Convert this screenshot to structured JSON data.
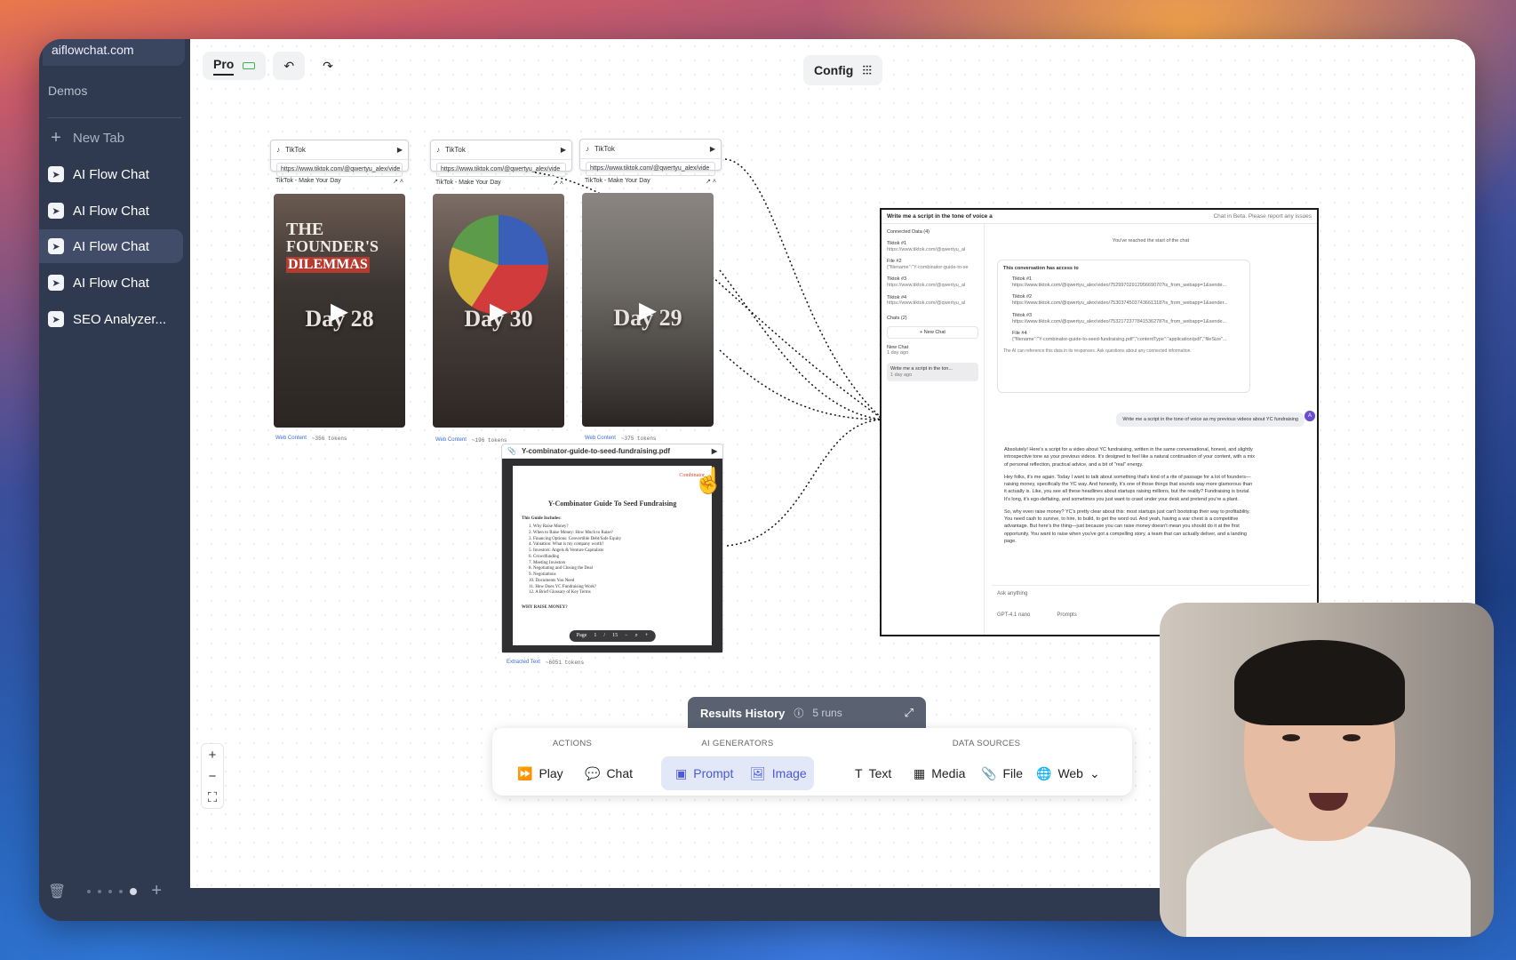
{
  "browser": {
    "domain": "aiflowchat.com"
  },
  "sidebar": {
    "section": "Demos",
    "new_tab": "New Tab",
    "items": [
      {
        "label": "AI Flow Chat",
        "active": false
      },
      {
        "label": "AI Flow Chat",
        "active": false
      },
      {
        "label": "AI Flow Chat",
        "active": true
      },
      {
        "label": "AI Flow Chat",
        "active": false
      },
      {
        "label": "SEO Analyzer...",
        "active": false
      }
    ]
  },
  "topbar": {
    "plan": "Pro",
    "config": "Config"
  },
  "tiktok_nodes": [
    {
      "source": "TikTok",
      "url": "https://www.tiktok.com/@qwertyu_alex/vide",
      "title": "TikTok - Make Your Day",
      "overlay": "Day 28",
      "tag": "Web Content",
      "tokens": "~356 tokens"
    },
    {
      "source": "TikTok",
      "url": "https://www.tiktok.com/@qwertyu_alex/vide",
      "title": "TikTok - Make Your Day",
      "overlay": "Day 30",
      "tag": "Web Content",
      "tokens": "~196 tokens"
    },
    {
      "source": "TikTok",
      "url": "https://www.tiktok.com/@qwertyu_alex/vide",
      "title": "TikTok - Make Your Day",
      "overlay": "Day 29",
      "tag": "Web Content",
      "tokens": "~375 tokens"
    }
  ],
  "video1_caption": [
    "THE",
    "FOUNDER'S",
    "DILEMMAS"
  ],
  "pdf_node": {
    "filename": "Y-combinator-guide-to-seed-fundraising.pdf",
    "brand": "Combinator",
    "heading": "Y-Combinator Guide To Seed Fundraising",
    "includes": "This Guide Includes:",
    "items": [
      "1. Why Raise Money?",
      "2. When to Raise Money: How Much to Raise?",
      "3. Financing Options: Convertible Debt/Safe Equity",
      "4. Valuation: What is my company worth?",
      "5. Investors: Angels & Venture Capitalists",
      "6. Crowdfunding",
      "7. Meeting Investors",
      "8. Negotiating and Closing the Deal",
      "9. Negotiations",
      "10. Documents You Need",
      "11. How Does YC Fundraising Work?",
      "12. A Brief Glossary of Key Terms"
    ],
    "why": "WHY RAISE MONEY?",
    "pager": {
      "label": "Page",
      "current": "1",
      "total": "15"
    },
    "tag": "Extracted Text",
    "tokens": "~6051 tokens"
  },
  "chat": {
    "header": "Write me a script in the tone of voice a",
    "beta": "Chat in Beta. Please report any issues",
    "connected_label": "Connected Data (4)",
    "connected": [
      {
        "name": "Tiktok #1",
        "sub": "https://www.tiktok.com/@qwertyu_al"
      },
      {
        "name": "File #2",
        "sub": "{\"filename\":\"Y-combinator-guide-to-se"
      },
      {
        "name": "Tiktok #3",
        "sub": "https://www.tiktok.com/@qwertyu_al"
      },
      {
        "name": "Tiktok #4",
        "sub": "https://www.tiktok.com/@qwertyu_al"
      }
    ],
    "chats_label": "Chats (2)",
    "new_chat": "New Chat",
    "history": [
      {
        "title": "New Chat",
        "time": "1 day ago"
      },
      {
        "title": "Write me a script in the ton...",
        "time": "1 day ago"
      }
    ],
    "start_note": "You've reached the start of the chat",
    "access_title": "This conversation has access to",
    "access": [
      {
        "name": "Tiktok #1",
        "sub": "https://www.tiktok.com/@qwertyu_alex/video/7529970291295669070?is_from_webapp=1&sende..."
      },
      {
        "name": "Tiktok #2",
        "sub": "https://www.tiktok.com/@qwertyu_alex/video/7530374503743661318?is_from_webapp=1&sender..."
      },
      {
        "name": "Tiktok #3",
        "sub": "https://www.tiktok.com/@qwertyu_alex/video/7532172377841536278?is_from_webapp=1&sende..."
      },
      {
        "name": "File #4",
        "sub": "{\"filename\":\"Y-combinator-guide-to-seed-fundraising.pdf\",\"contentType\":\"application/pdf\",\"fileSize\"..."
      }
    ],
    "access_note": "The AI can reference this data in its responses. Ask questions about any connected information.",
    "user_msg": "Write me a script in the tone of voice as my previous videos about YC fundraising",
    "avatar": "A",
    "assistant": [
      "Absolutely! Here's a script for a video about YC fundraising, written in the same conversational, honest, and slightly introspective tone as your previous videos. It's designed to feel like a natural continuation of your content, with a mix of personal reflection, practical advice, and a bit of \"real\" energy.",
      "Hey folks, it's me again. Today I want to talk about something that's kind of a rite of passage for a lot of founders—raising money, specifically the YC way. And honestly, it's one of those things that sounds way more glamorous than it actually is. Like, you see all these headlines about startups raising millions, but the reality? Fundraising is brutal. It's long, it's ego-deflating, and sometimes you just want to crawl under your desk and pretend you're a plant.",
      "So, why even raise money? YC's pretty clear about this: most startups just can't bootstrap their way to profitability. You need cash to survive, to hire, to build, to get the word out. And yeah, having a war chest is a competitive advantage. But here's the thing—just because you can raise money doesn't mean you should do it at the first opportunity. You want to raise when you've got a compelling story, a team that can actually deliver, and a landing page."
    ],
    "ask_placeholder": "Ask anything",
    "model": "GPT-4.1 nano",
    "prompts": "Prompts"
  },
  "results": {
    "label": "Results History",
    "runs": "5 runs"
  },
  "toolbar": {
    "actions_label": "ACTIONS",
    "generators_label": "AI GENERATORS",
    "sources_label": "DATA SOURCES",
    "play": "Play",
    "chat": "Chat",
    "prompt": "Prompt",
    "image": "Image",
    "text": "Text",
    "media": "Media",
    "file": "File",
    "web": "Web"
  }
}
